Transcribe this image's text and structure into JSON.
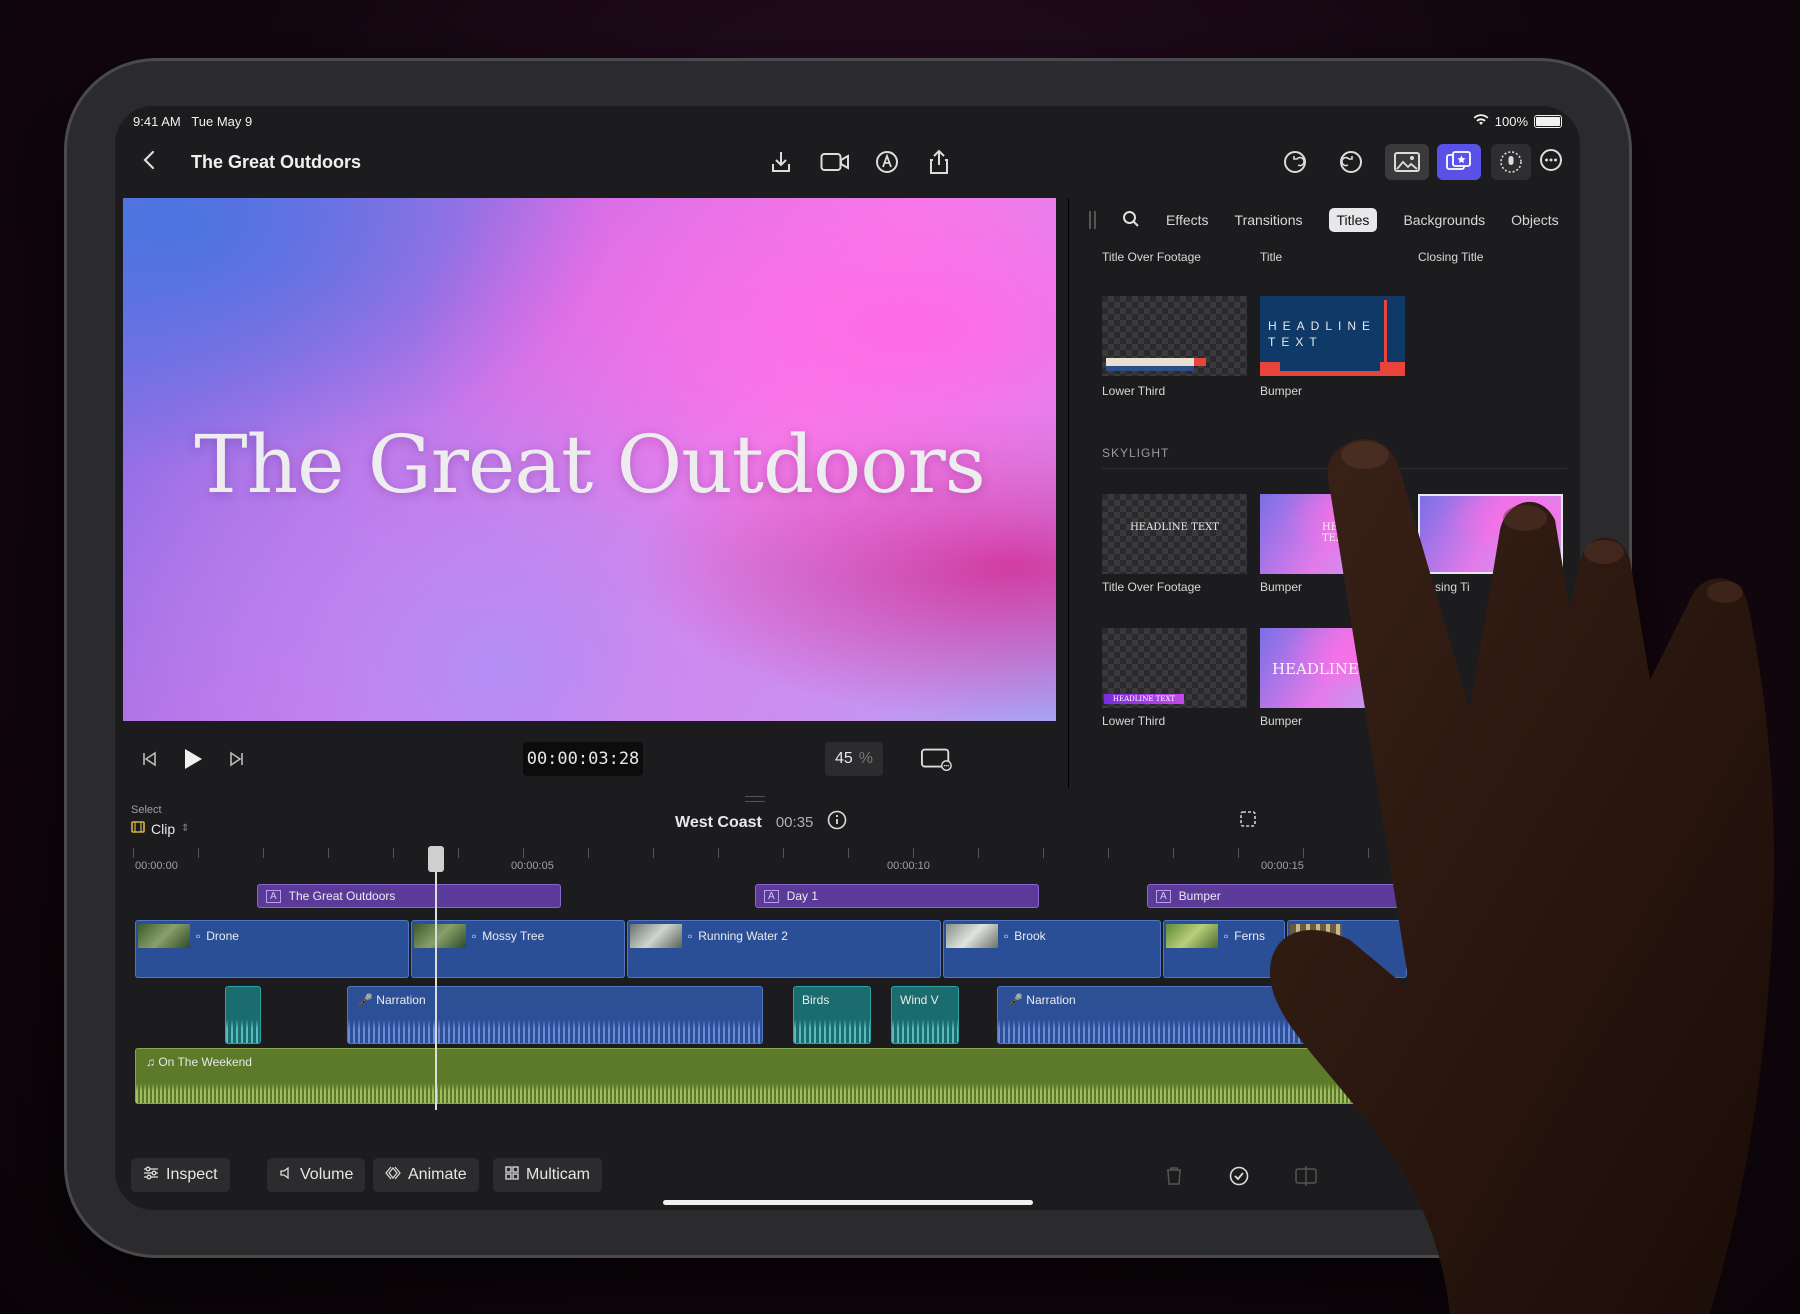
{
  "status_bar": {
    "time": "9:41 AM",
    "date": "Tue May 9",
    "wifi": "wifi-icon",
    "battery": "100%"
  },
  "nav": {
    "title": "The Great Outdoors"
  },
  "viewer": {
    "title": "The Great Outdoors",
    "timecode": "00:00:03:28",
    "zoom": "45",
    "zoom_unit": "%"
  },
  "browser": {
    "tabs": [
      "Effects",
      "Transitions",
      "Titles",
      "Backgrounds",
      "Objects"
    ],
    "active_tab": "Titles",
    "top_labels": [
      "Title Over Footage",
      "Title",
      "Closing Title"
    ],
    "row1": [
      {
        "label": "Lower Third"
      },
      {
        "label": "Bumper",
        "text": "HEADLINE TEXT"
      }
    ],
    "section": "SKYLIGHT",
    "row2": [
      {
        "label": "Title Over Footage",
        "text": "HEADLINE TEXT"
      },
      {
        "label": "Title",
        "text": "HEADLI TEX"
      },
      {
        "label": "sing Ti"
      }
    ],
    "row3": [
      {
        "label": "Lower Third",
        "text": "HEADLINE TEXT"
      },
      {
        "label": "Bumper",
        "text": "HEADLINE TEX"
      }
    ]
  },
  "timeline": {
    "select_label": "Select",
    "select_value": "Clip",
    "project": "West Coast",
    "duration": "00:35",
    "ruler": [
      "00:00:00",
      "00:00:05",
      "00:00:10",
      "00:00:15"
    ],
    "titles": [
      {
        "name": "The Great Outdoors"
      },
      {
        "name": "Day 1"
      },
      {
        "name": "Bumper"
      }
    ],
    "video_clips": [
      {
        "name": "Drone"
      },
      {
        "name": "Mossy Tree"
      },
      {
        "name": "Running Water 2"
      },
      {
        "name": "Brook"
      },
      {
        "name": "Ferns"
      }
    ],
    "audio_clips": [
      {
        "name": "Narration"
      },
      {
        "name": "Birds"
      },
      {
        "name": "Wind V"
      },
      {
        "name": "Narration"
      }
    ],
    "music": "On The Weekend"
  },
  "toolbar": {
    "inspect": "Inspect",
    "volume": "Volume",
    "animate": "Animate",
    "multicam": "Multicam"
  }
}
